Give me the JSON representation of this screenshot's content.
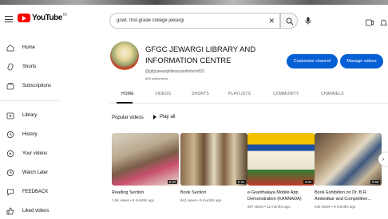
{
  "header": {
    "logo_text": "YouTube",
    "logo_country": "IN",
    "search_query": "gowt. first-grade college jewargi"
  },
  "sidebar": {
    "items": [
      {
        "label": "Home",
        "icon": "home-icon"
      },
      {
        "label": "Shorts",
        "icon": "shorts-icon"
      },
      {
        "label": "Subscriptions",
        "icon": "subscriptions-icon"
      },
      {
        "label": "Library",
        "icon": "library-icon"
      },
      {
        "label": "History",
        "icon": "history-icon"
      },
      {
        "label": "Your videos",
        "icon": "your-videos-icon"
      },
      {
        "label": "Watch Later",
        "icon": "watch-later-icon"
      },
      {
        "label": "FEEDBACK",
        "icon": "feedback-icon"
      },
      {
        "label": "Liked videos",
        "icon": "liked-videos-icon"
      }
    ]
  },
  "channel": {
    "title": "GFGC JEWARGI LIBRARY AND INFORMATION CENTRE",
    "handle": "@gfgcjewargilibraryandinform831",
    "meta": "895 subscribers",
    "customise_label": "Customise channel",
    "manage_label": "Manage videos"
  },
  "tabs": [
    "HOME",
    "VIDEOS",
    "SHORTS",
    "PLAYLISTS",
    "COMMUNITY",
    "CHANNELS"
  ],
  "popular": {
    "label": "Popular videos",
    "play_all": "Play all"
  },
  "videos": [
    {
      "title": "Reading Section",
      "meta": "1.5K views • 9 months ago",
      "duration": "0:37"
    },
    {
      "title": "Book Section",
      "meta": "941 views • 9 months ago",
      "duration": "0:31"
    },
    {
      "title": "e-Granthalaya Mobile App Demonstration (KANNADA)",
      "meta": "867 views • 11 months ago",
      "duration": "3:01"
    },
    {
      "title": "Book Exhibition on Dr. B.R. Ambedkar and Competitive...",
      "meta": "646 views • 9 months ago",
      "duration": "0:58"
    }
  ],
  "colors": {
    "accent_blue": "#065fd4",
    "brand_red": "#ff0000"
  }
}
